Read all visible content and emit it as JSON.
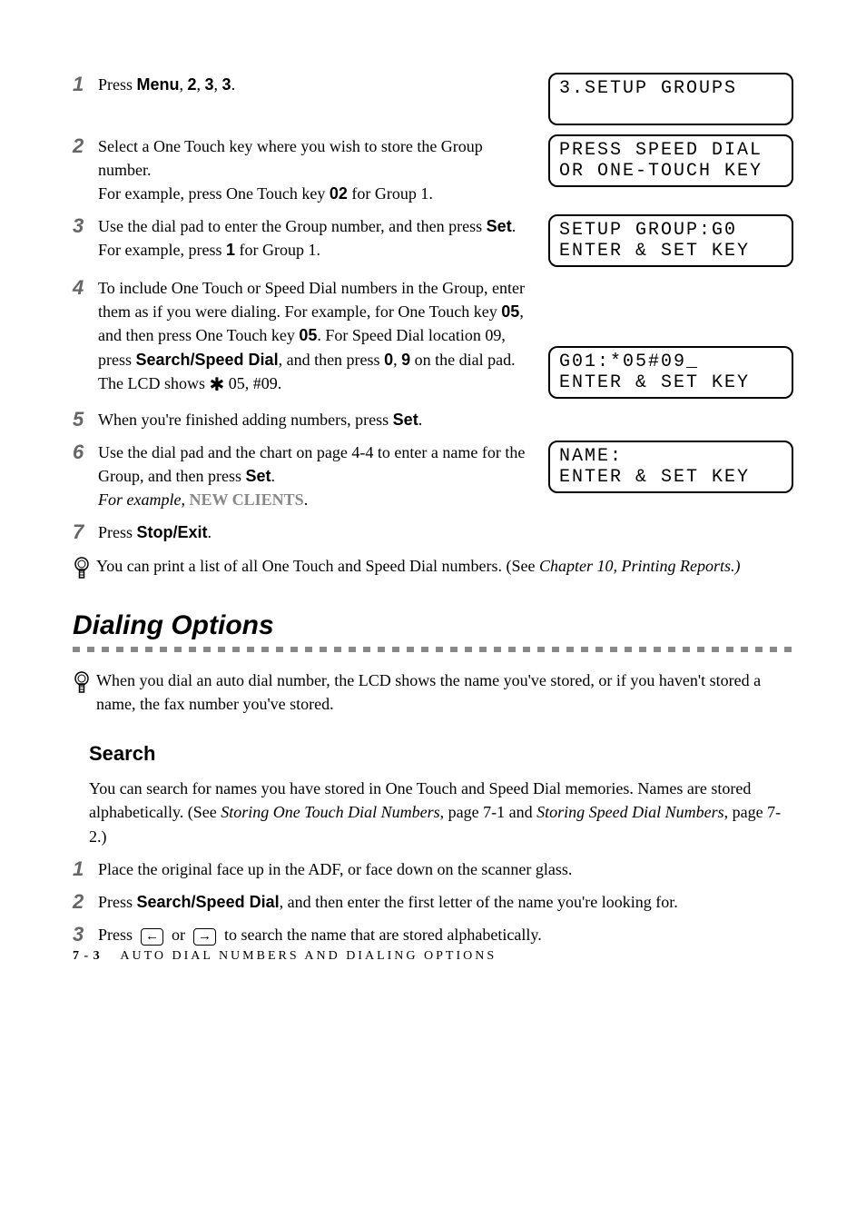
{
  "steps_a": [
    {
      "num": "1",
      "html": "Press <b>Menu</b>, <b>2</b>, <b>3</b>, <b>3</b>.",
      "lcd": "3.SETUP GROUPS\n ",
      "lcd_class": "lcd"
    },
    {
      "num": "2",
      "html": "Select a One Touch key where you wish to store the Group number.<br>For example, press One Touch key <b>02</b> for Group 1.",
      "lcd": "PRESS SPEED DIAL\nOR ONE-TOUCH KEY",
      "lcd_class": "lcd"
    },
    {
      "num": "3",
      "html": "Use the dial pad to enter the Group number, and then press <b>Set</b>.<br>For example, press <b>1</b> for Group 1.",
      "lcd": "SETUP GROUP:G0\nENTER & SET KEY",
      "lcd_class": "lcd"
    },
    {
      "num": "4",
      "html": "To include One Touch or Speed Dial numbers in the Group, enter them as if you were dialing. For example, for One Touch key <b>05</b>, and then press One Touch key <b>05</b>. For Speed Dial location 09, press <b>Search/Speed Dial</b>, and then press <b>0</b>, <b>9</b> on the dial pad. The LCD shows&nbsp;<span class='star-glyph'>&#10033;</span> 05, #09.",
      "lcd": "G01:*05#09_\nENTER & SET KEY",
      "lcd_class": "lcd",
      "lcd_valign": "bottom"
    },
    {
      "num": "5",
      "html": "When you're finished adding numbers, press <b>Set</b>.",
      "lcd": null
    },
    {
      "num": "6",
      "html": "Use the dial pad and the chart on page 4-4 to enter a name for the Group, and then press <b>Set</b>.<br><em class='instr'>For example</em>, <span class='newclients'>NEW CLIENTS</span>.",
      "lcd": "NAME:\nENTER & SET KEY",
      "lcd_class": "lcd"
    },
    {
      "num": "7",
      "html": "Press <b>Stop/Exit</b>.",
      "lcd": null
    }
  ],
  "tip1": "You can print a list of all One Touch and Speed Dial numbers.  (See <em>Chapter 10, Printing Reports.)</em>",
  "section_title": "Dialing Options",
  "tip2": "When you dial an auto dial number, the LCD shows the name you've stored, or if you haven't stored a name, the fax number you've stored.",
  "subsection_title": "Search",
  "search_para": "You can search for names you have stored in One Touch and Speed Dial memories. Names are stored alphabetically. (See <em>Storing One Touch Dial Numbers</em>, page 7-1 and <em>Storing Speed Dial Numbers</em>, page 7-2.)",
  "steps_b": [
    {
      "num": "1",
      "html": "Place the original face up in the ADF, or face down on the scanner glass."
    },
    {
      "num": "2",
      "html": "Press <b>Search/Speed Dial</b>, and then enter the first letter of the name you're looking for."
    },
    {
      "num": "3",
      "html": "Press &nbsp;<span class='arrow-box'>&larr;</span>&nbsp; or &nbsp;<span class='arrow-box'>&rarr;</span>&nbsp; to search the name that are stored alphabetically."
    }
  ],
  "footer": {
    "page": "7 - 3",
    "title": "AUTO DIAL NUMBERS AND DIALING OPTIONS"
  }
}
